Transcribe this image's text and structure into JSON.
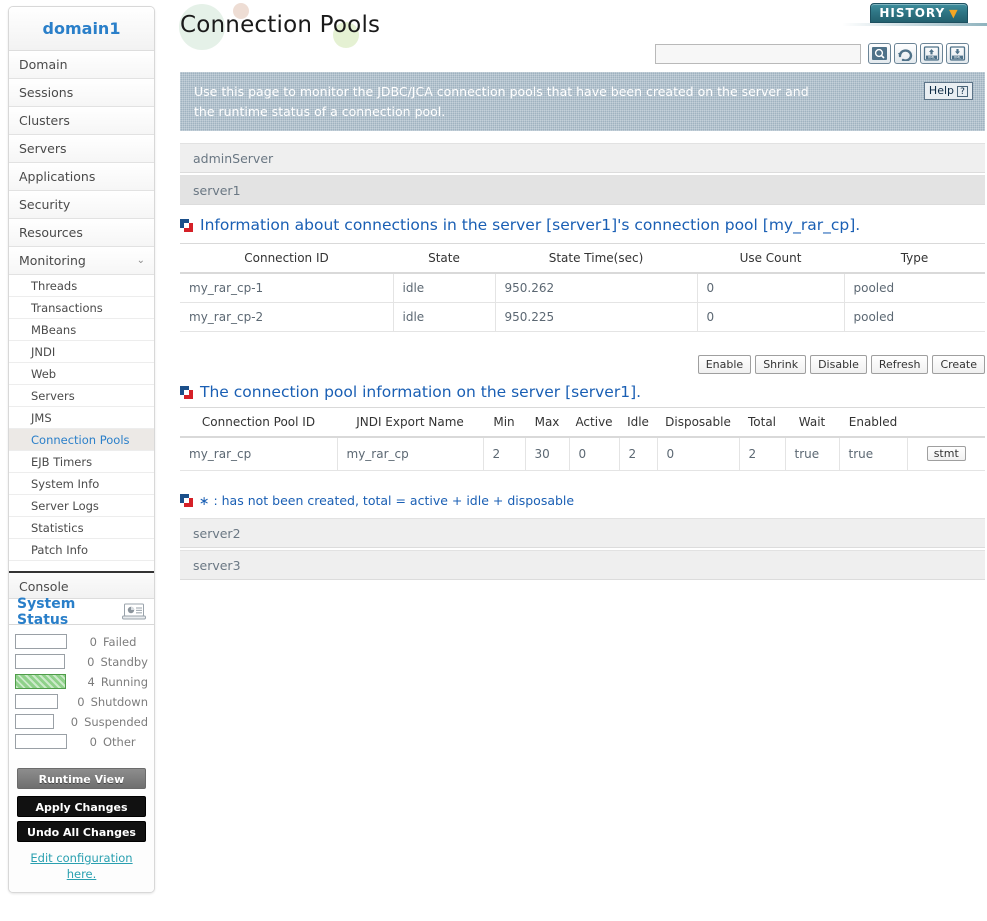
{
  "sidebar": {
    "domain_title": "domain1",
    "nav_items": [
      {
        "label": "Domain"
      },
      {
        "label": "Sessions"
      },
      {
        "label": "Clusters"
      },
      {
        "label": "Servers"
      },
      {
        "label": "Applications"
      },
      {
        "label": "Security"
      },
      {
        "label": "Resources"
      },
      {
        "label": "Monitoring",
        "chevron": "⌄",
        "expanded": true
      }
    ],
    "sub_items": [
      {
        "label": "Threads"
      },
      {
        "label": "Transactions"
      },
      {
        "label": "MBeans"
      },
      {
        "label": "JNDI"
      },
      {
        "label": "Web"
      },
      {
        "label": "Servers"
      },
      {
        "label": "JMS"
      },
      {
        "label": "Connection Pools",
        "active": true
      },
      {
        "label": "EJB Timers"
      },
      {
        "label": "System Info"
      },
      {
        "label": "Server Logs"
      },
      {
        "label": "Statistics"
      },
      {
        "label": "Patch Info"
      }
    ],
    "console_label": "Console",
    "system_status": {
      "title": "System Status",
      "icon": "laptop-chart-icon",
      "rows": [
        {
          "count": "0",
          "label": "Failed",
          "filled": false
        },
        {
          "count": "0",
          "label": "Standby",
          "filled": false
        },
        {
          "count": "4",
          "label": "Running",
          "filled": true
        },
        {
          "count": "0",
          "label": "Shutdown",
          "filled": false
        },
        {
          "count": "0",
          "label": "Suspended",
          "filled": false
        },
        {
          "count": "0",
          "label": "Other",
          "filled": false
        }
      ],
      "running_color": "#8fd18a"
    },
    "actions": {
      "runtime_view": "Runtime View",
      "apply_changes": "Apply Changes",
      "undo_all_changes": "Undo All Changes",
      "edit_config_line1": "Edit configuration",
      "edit_config_line2": "here."
    }
  },
  "header": {
    "page_title": "Connection Pools",
    "history_label": "HISTORY",
    "history_chevron": "▼",
    "history_color": "#2f7685",
    "history_chevron_color": "#f5a623"
  },
  "toolbar": {
    "search_value": "",
    "search_placeholder": "",
    "icons": [
      {
        "name": "search-icon"
      },
      {
        "name": "refresh-icon"
      },
      {
        "name": "xml-upload-icon"
      },
      {
        "name": "xml-download-icon"
      }
    ]
  },
  "info_banner": {
    "line1": "Use this page to monitor the JDBC/JCA connection pools that have been created on the server and",
    "line2": "the runtime status of a connection pool.",
    "help_label": "Help",
    "help_glyph": "?"
  },
  "server_rows_top": [
    {
      "label": "adminServer"
    },
    {
      "label": "server1"
    }
  ],
  "server_rows_bottom": [
    {
      "label": "server2"
    },
    {
      "label": "server3"
    }
  ],
  "connections_section": {
    "heading": "Information about connections in the server [server1]'s connection pool [my_rar_cp].",
    "columns": [
      "Connection ID",
      "State",
      "State Time(sec)",
      "Use Count",
      "Type"
    ],
    "rows": [
      [
        "my_rar_cp-1",
        "idle",
        "950.262",
        "0",
        "pooled"
      ],
      [
        "my_rar_cp-2",
        "idle",
        "950.225",
        "0",
        "pooled"
      ]
    ],
    "buttons": [
      "Enable",
      "Shrink",
      "Disable",
      "Refresh",
      "Create"
    ]
  },
  "pool_section": {
    "heading": "The connection pool information on the server [server1].",
    "columns": [
      "Connection Pool ID",
      "JNDI Export Name",
      "Min",
      "Max",
      "Active",
      "Idle",
      "Disposable",
      "Total",
      "Wait",
      "Enabled",
      ""
    ],
    "rows": [
      [
        "my_rar_cp",
        "my_rar_cp",
        "2",
        "30",
        "0",
        "2",
        "0",
        "2",
        "true",
        "true"
      ]
    ],
    "row_action_label": "stmt"
  },
  "footnote": {
    "text": "∗ : has not been created, total = active + idle + disposable"
  }
}
